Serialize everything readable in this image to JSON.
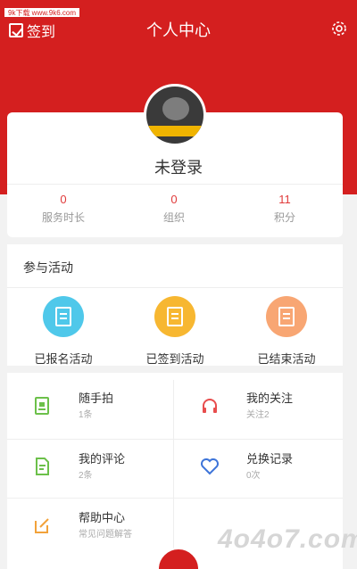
{
  "header": {
    "watermark": "9k下载 www.9k6.com",
    "checkin_label": "签到",
    "title": "个人中心"
  },
  "profile": {
    "name": "未登录",
    "stats": [
      {
        "value": "0",
        "label": "服务时长"
      },
      {
        "value": "0",
        "label": "组织"
      },
      {
        "value": "11",
        "label": "积分"
      }
    ]
  },
  "activities": {
    "title": "参与活动",
    "items": [
      {
        "label": "已报名活动",
        "color": "#4fc8ea"
      },
      {
        "label": "已签到活动",
        "color": "#f7b731"
      },
      {
        "label": "已结束活动",
        "color": "#f8a673"
      }
    ]
  },
  "menu": [
    {
      "title": "随手拍",
      "sub": "1条",
      "icon": "camera-doc-icon",
      "color": "#6cc04a"
    },
    {
      "title": "我的关注",
      "sub": "关注2",
      "icon": "headphone-icon",
      "color": "#e84d4d"
    },
    {
      "title": "我的评论",
      "sub": "2条",
      "icon": "comment-doc-icon",
      "color": "#6cc04a"
    },
    {
      "title": "兑换记录",
      "sub": "0次",
      "icon": "heart-icon",
      "color": "#3d74d9"
    },
    {
      "title": "帮助中心",
      "sub": "常见问题解答",
      "icon": "edit-icon",
      "color": "#f2a23a"
    }
  ],
  "watermark_bottom": "4o4o7.com"
}
